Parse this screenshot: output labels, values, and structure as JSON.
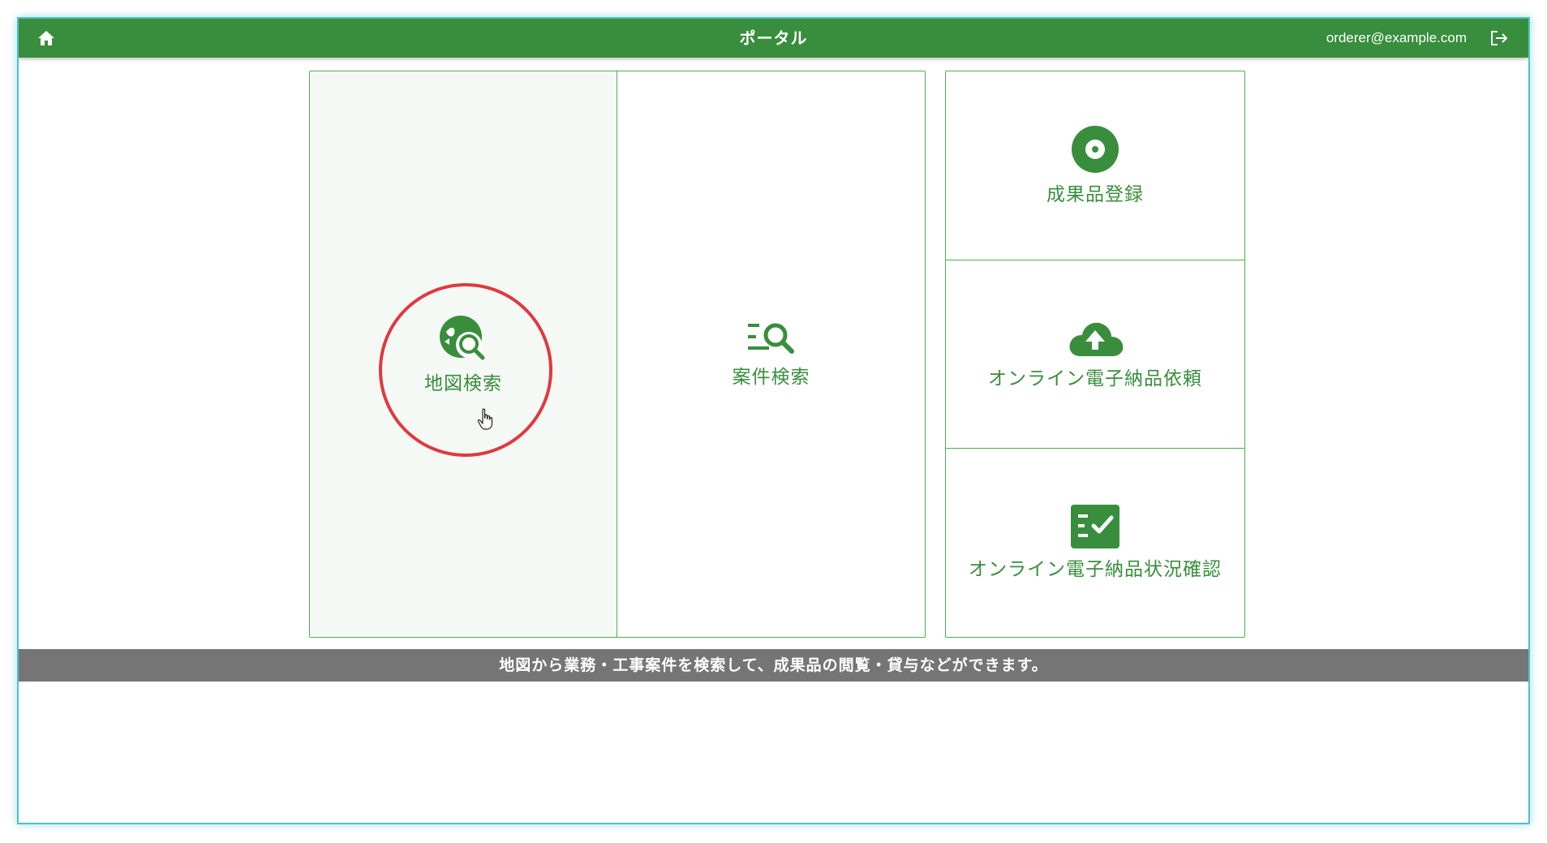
{
  "header": {
    "title": "ポータル",
    "user_email": "orderer@example.com",
    "home_icon": "home-icon",
    "logout_icon": "logout-icon",
    "background": "#388e3c"
  },
  "tiles": {
    "map_search": {
      "label": "地図検索",
      "icon": "globe-search-icon"
    },
    "case_search": {
      "label": "案件検索",
      "icon": "list-search-icon"
    },
    "deliverable_registration": {
      "label": "成果品登録",
      "icon": "disc-icon"
    },
    "online_delivery_request": {
      "label": "オンライン電子納品依頼",
      "icon": "cloud-upload-icon"
    },
    "online_delivery_status": {
      "label": "オンライン電子納品状況確認",
      "icon": "checklist-icon"
    }
  },
  "info_bar": {
    "text": "地図から業務・工事案件を検索して、成果品の閲覧・貸与などができます。"
  },
  "colors": {
    "accent": "#388e3c",
    "tile_border": "#4caf50",
    "selected_tile_bg": "#f5f9f5",
    "info_bar_bg": "#757575",
    "highlight_ring": "#e0393e"
  }
}
